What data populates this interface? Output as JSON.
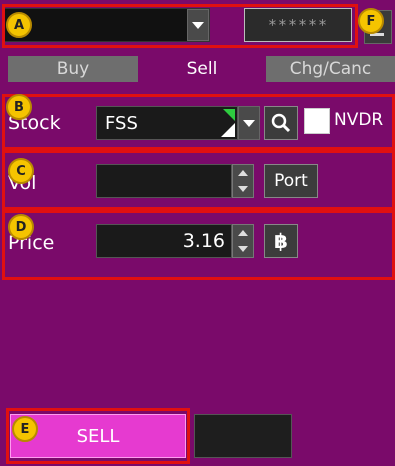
{
  "header": {
    "account_value": "",
    "password_mask": "******"
  },
  "tabs": [
    {
      "label": "Buy",
      "active": false
    },
    {
      "label": "Sell",
      "active": true
    },
    {
      "label": "Chg/Canc",
      "active": false
    }
  ],
  "stock": {
    "label": "Stock",
    "value": "FSS",
    "nvdr_label": "NVDR",
    "nvdr_checked": false
  },
  "volume": {
    "label": "Vol",
    "value": "",
    "port_label": "Port"
  },
  "price": {
    "label": "Price",
    "value": "3.16",
    "currency_symbol": "฿"
  },
  "actions": {
    "sell_label": "SELL"
  },
  "annotations": {
    "markers": [
      "A",
      "B",
      "C",
      "D",
      "E",
      "F"
    ]
  },
  "colors": {
    "panel_bg": "#7a0a6a",
    "sell_button": "#e63ad0",
    "annotation_frame": "#e01010",
    "marker": "#f5c400"
  }
}
